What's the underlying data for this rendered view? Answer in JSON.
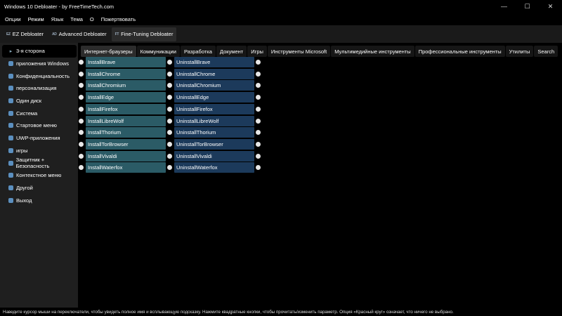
{
  "window": {
    "title": "Windows 10 Debloater - by FreeTimeTech.com",
    "minimize": "—",
    "maximize": "☐",
    "close": "✕"
  },
  "menu": [
    "Опции",
    "Режим",
    "Язык",
    "Тема",
    "О",
    "Пожертвовать"
  ],
  "modes": [
    {
      "icon": "EZ",
      "label": "EZ Debloater"
    },
    {
      "icon": "AD",
      "label": "Advanced Debloater"
    },
    {
      "icon": "FT",
      "label": "Fine-Tuning Debloater"
    }
  ],
  "sidebar": [
    "3-я сторона",
    "приложения Windows",
    "Конфиденциальность",
    "персонализация",
    "Один диск",
    "Система",
    "Стартовое меню",
    "UWP-приложения",
    "игры",
    "Защитник + Безопасность",
    "Контекстное меню",
    "Другой",
    "Выход"
  ],
  "tabs": [
    "Интернет-браузеры",
    "Коммуникации",
    "Разработка",
    "Документ",
    "Игры",
    "Инструменты Microsoft",
    "Мультимедийные инструменты",
    "Профессиональные инструменты",
    "Утилиты",
    "Search"
  ],
  "rows": [
    {
      "install": "InstallBrave",
      "uninstall": "UninstallBrave"
    },
    {
      "install": "InstallChrome",
      "uninstall": "UninstallChrome"
    },
    {
      "install": "InstallChromium",
      "uninstall": "UninstallChromium"
    },
    {
      "install": "InstallEdge",
      "uninstall": "UninstallEdge"
    },
    {
      "install": "InstallFirefox",
      "uninstall": "UninstallFirefox"
    },
    {
      "install": "InstallLibreWolf",
      "uninstall": "UninstallLibreWolf"
    },
    {
      "install": "InstallThorium",
      "uninstall": "UninstallThorium"
    },
    {
      "install": "InstallTorBrowser",
      "uninstall": "UninstallTorBrowser"
    },
    {
      "install": "InstallVivaldi",
      "uninstall": "UninstallVivaldi"
    },
    {
      "install": "InstallWaterfox",
      "uninstall": "UninstallWaterfox"
    }
  ],
  "status": "Наведите курсор мыши на переключатели, чтобы увидеть полное имя и всплывающую подсказку. Нажмите квадратные кнопки, чтобы прочитать/изменить параметр. Опция «Красный круг» означает, что ничего не выбрано."
}
